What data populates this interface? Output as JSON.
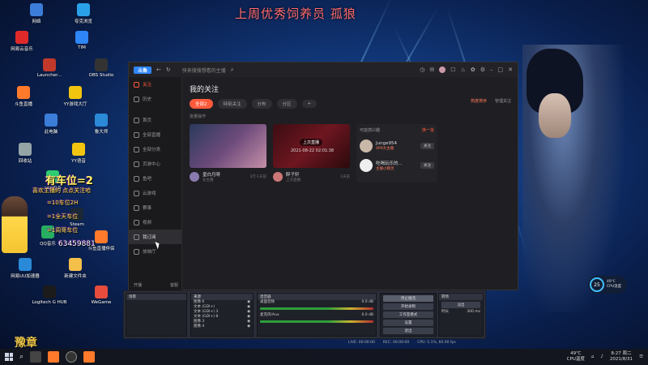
{
  "banner": "上周优秀饲养员 孤狼",
  "desktop_icons": [
    {
      "label": "网络",
      "color": "#3b7dd8"
    },
    {
      "label": "夸克浏览",
      "color": "#2aa0e8"
    },
    {
      "label": "网易云音乐",
      "color": "#e02a2a"
    },
    {
      "label": "TIM",
      "color": "#2f86f6"
    },
    {
      "label": "Launcher...",
      "color": "#c0392b"
    },
    {
      "label": "OBS Studio",
      "color": "#333"
    },
    {
      "label": "斗鱼直播",
      "color": "#ff7a2a"
    },
    {
      "label": "YY游戏大厅",
      "color": "#f1c40f"
    },
    {
      "label": "此电脑",
      "color": "#3b7dd8"
    },
    {
      "label": "鲁大师",
      "color": "#2a8ad8"
    },
    {
      "label": "回收站",
      "color": "#95a5a6"
    },
    {
      "label": "YY语音",
      "color": "#f1c40f"
    },
    {
      "label": "360安全",
      "color": "#2ecc71"
    },
    {
      "label": "Steam",
      "color": "#1b2838"
    },
    {
      "label": "QQ音乐",
      "color": "#27ae60"
    },
    {
      "label": "斗鱼直播伴侣",
      "color": "#ff7a2a"
    },
    {
      "label": "网易UU加速器",
      "color": "#2a8ad8"
    },
    {
      "label": "新建文件夹",
      "color": "#f5c04a"
    },
    {
      "label": "Logitech G HUB",
      "color": "#1b1b1b"
    },
    {
      "label": "WeGame",
      "color": "#e74c3c"
    }
  ],
  "overlay": {
    "title": "有车位=2",
    "line1": "喜欢主播的 点点关注哈",
    "line2": "=10车位2H",
    "line3": "=1全天车位",
    "line4": "=1周哥车位",
    "qq": "63459881",
    "bottom_logo": "豫章"
  },
  "app": {
    "logo": "斗鱼",
    "search_placeholder": "快来搜搜想看的主播",
    "sidebar": [
      {
        "label": "关注",
        "icon": "heart-icon",
        "state": "active"
      },
      {
        "label": "历史",
        "icon": "history-icon",
        "state": ""
      },
      {
        "label": "首页",
        "icon": "home-icon",
        "state": ""
      },
      {
        "label": "全部直播",
        "icon": "live-icon",
        "state": ""
      },
      {
        "label": "全部分类",
        "icon": "category-icon",
        "state": ""
      },
      {
        "label": "页游中心",
        "icon": "game-icon",
        "state": ""
      },
      {
        "label": "鱼吧",
        "icon": "fish-icon",
        "state": ""
      },
      {
        "label": "云游戏",
        "icon": "cloud-icon",
        "state": ""
      },
      {
        "label": "赛事",
        "icon": "trophy-icon",
        "state": ""
      },
      {
        "label": "视频",
        "icon": "video-icon",
        "state": ""
      },
      {
        "label": "我订阅",
        "icon": "subscribe-icon",
        "state": "selected"
      },
      {
        "label": "放映厅",
        "icon": "cinema-icon",
        "state": ""
      }
    ],
    "sb_bottom_left": "开播",
    "sb_bottom_right": "客服",
    "page_title": "我的关注",
    "tabs": [
      "全部2",
      "特别关注",
      "分布",
      "分区"
    ],
    "subtool_1": "热度排序",
    "subtool_2": "管理关注",
    "sort_label": "批量操作",
    "cards": [
      {
        "name": "皇白月呀",
        "sub": "女主播",
        "meta": "3万·1天前"
      },
      {
        "name": "醉子轩",
        "sub": "上次直播",
        "meta": "1天前",
        "rec": "上次直播",
        "time": "2021-08-22 02:01:38"
      }
    ],
    "maybe": {
      "title": "可能感兴趣",
      "refresh": "换一批",
      "items": [
        {
          "name": "Junge954",
          "sub": "4P0大主播",
          "btn": "关注"
        },
        {
          "name": "吃喝玩乐的...",
          "sub": "主播小精灵",
          "btn": "关注"
        }
      ]
    }
  },
  "obs": {
    "scenes_head": "场景",
    "sources_head": "来源",
    "sources": [
      "图像 6",
      "文本 (GDI+)",
      "文本 (GDI+) 3",
      "文本 (GDI+) 8",
      "图像 3",
      "图像 4"
    ],
    "mixer_head": "混音器",
    "mixer": [
      "桌面音频",
      "麦克风/Aux"
    ],
    "mixer_db": [
      "0.0 dB",
      "0.0 dB"
    ],
    "controls_head": "控件",
    "controls": [
      "停止推流",
      "开始录制",
      "工作室模式",
      "设置",
      "退出"
    ],
    "transitions_head": "转场",
    "transition": "淡出",
    "duration_label": "时长",
    "duration": "300 ms",
    "status": [
      "LIVE: 00:00:00",
      "REC: 00:00:00",
      "CPU: 5.1%, 60.00 fps"
    ]
  },
  "cpu_widget": {
    "value": "25",
    "unit": "%",
    "temp": "49℃",
    "label": "CPU温度"
  },
  "taskbar": {
    "temp": "49℃",
    "temp_label": "CPU温度",
    "time": "8:27 周二",
    "date": "2021/8/31"
  }
}
